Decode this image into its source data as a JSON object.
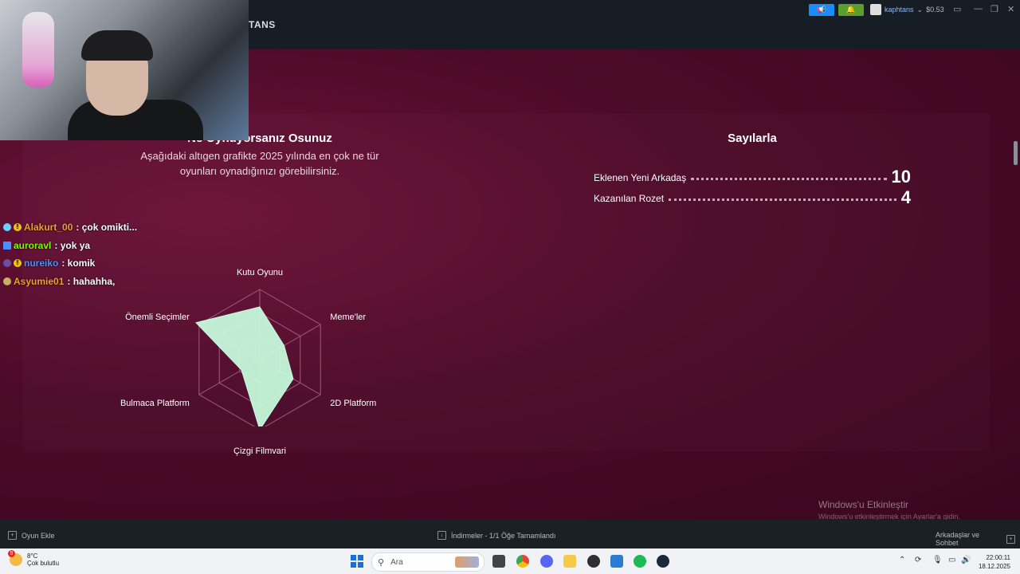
{
  "app": {
    "title_fragment": "TANS"
  },
  "account": {
    "username": "kaphtans",
    "balance": "$0.53"
  },
  "section_left": {
    "title": "Ne Oynuyorsanız Osunuz",
    "subtitle_line1": "Aşağıdaki altıgen grafikte 2025 yılında en çok ne tür",
    "subtitle_line2": "oyunları oynadığınızı görebilirsiniz."
  },
  "chart_data": {
    "type": "radar",
    "axes": [
      "Kutu Oyunu",
      "Meme'ler",
      "2D Platform",
      "Çizgi Filmvari",
      "Bulmaca Platform",
      "Önemli Seçimler"
    ],
    "values": [
      0.75,
      0.4,
      0.55,
      1.0,
      0.3,
      1.05
    ],
    "rings": 3,
    "range": [
      0,
      1
    ],
    "fill_color": "#c8ffe0",
    "grid": true
  },
  "section_right": {
    "title": "Sayılarla",
    "stats": [
      {
        "label": "Eklenen Yeni Arkadaş",
        "value": "10"
      },
      {
        "label": "Kazanılan Rozet",
        "value": "4"
      }
    ]
  },
  "chat": [
    {
      "user": "Alakurt_00",
      "message": ": çok omikti...",
      "color": "#f0a030"
    },
    {
      "user": "auroravl",
      "message": ": yok ya",
      "color": "#7cfc00"
    },
    {
      "user": "nureiko",
      "message": ": komik",
      "color": "#4a90ff"
    },
    {
      "user": "Asyumie01",
      "message": ": hahahha,",
      "color": "#f0a030"
    }
  ],
  "watermark": {
    "title": "Windows'u Etkinleştir",
    "subtitle": "Windows'u etkinleştirmek için Ayarlar'a gidin."
  },
  "bottom_bar": {
    "add_game": "Oyun Ekle",
    "downloads": "İndirmeler - 1/1 Öğe Tamamlandı",
    "friends": "Arkadaşlar ve Sohbet"
  },
  "taskbar": {
    "weather_temp": "8°C",
    "weather_desc": "Çok bulutlu",
    "weather_badge": "9",
    "search_placeholder": "Ara",
    "time": "22:00:11",
    "date": "18.12.2025"
  }
}
